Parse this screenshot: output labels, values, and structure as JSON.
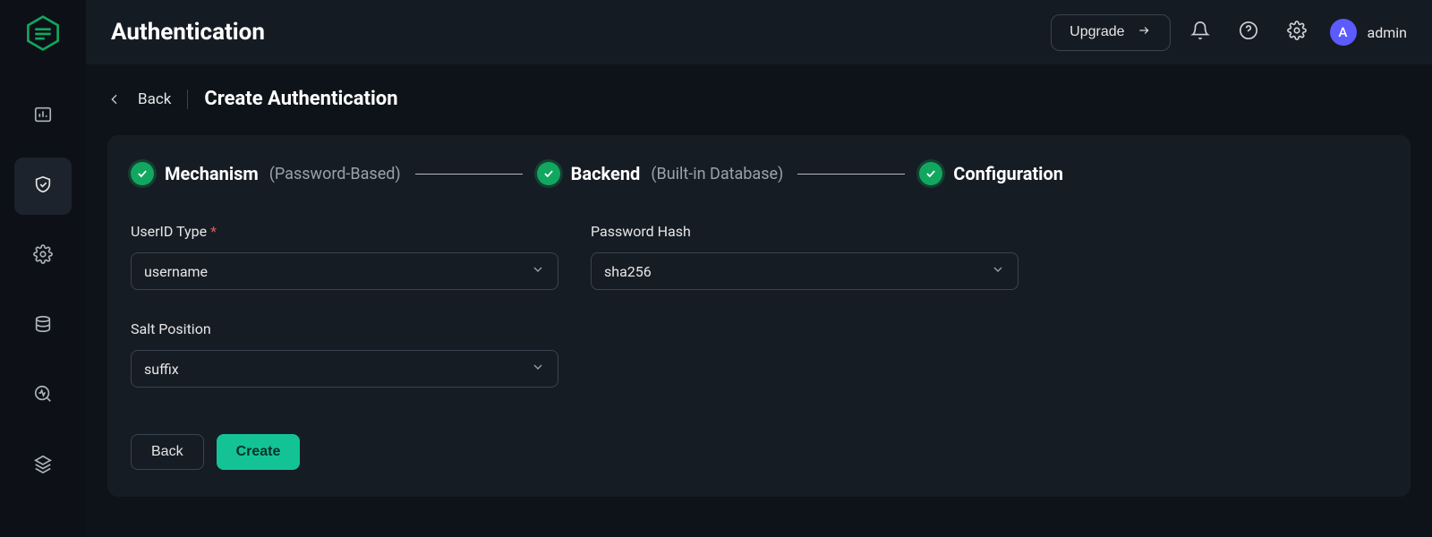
{
  "header": {
    "title": "Authentication",
    "upgrade_label": "Upgrade",
    "avatar_letter": "A",
    "username": "admin"
  },
  "breadcrumb": {
    "back_label": "Back",
    "page_title": "Create Authentication"
  },
  "stepper": {
    "step1": {
      "title": "Mechanism",
      "sub": "(Password-Based)"
    },
    "step2": {
      "title": "Backend",
      "sub": "(Built-in Database)"
    },
    "step3": {
      "title": "Configuration"
    }
  },
  "form": {
    "userid_label": "UserID Type",
    "userid_value": "username",
    "password_hash_label": "Password Hash",
    "password_hash_value": "sha256",
    "salt_label": "Salt Position",
    "salt_value": "suffix"
  },
  "buttons": {
    "back": "Back",
    "create": "Create"
  },
  "sidebar_icons": [
    "dashboard",
    "shield",
    "settings-cog",
    "database",
    "diagnose",
    "stack"
  ]
}
